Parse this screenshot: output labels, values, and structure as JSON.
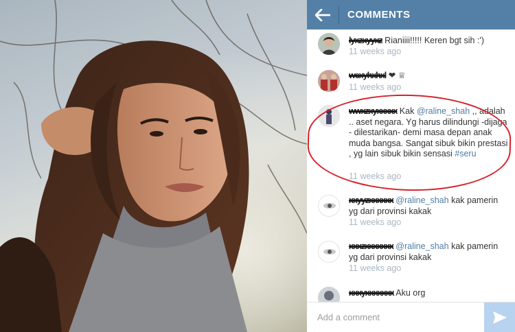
{
  "header": {
    "title": "COMMENTS",
    "back_icon": "arrow-left-icon"
  },
  "comments": [
    {
      "username": "lyxzxyyxz",
      "text": "Rianiiii!!!!! Keren bgt sih :')",
      "time": "11 weeks ago"
    },
    {
      "username": "wexyhxhxl",
      "text": "❤ ♕",
      "time": "11 weeks ago"
    },
    {
      "username": "wwxzxyxxxxx",
      "mention": "@raline_shah",
      "text": ",, adalah .. aset negara. Yg harus dilindungi -dijaga - dilestarikan- demi masa depan anak muda bangsa. Sangat sibuk bikin prestasi , yg lain sibuk bikin sensasi",
      "prefix": "Kak",
      "hashtag": "#seru",
      "time": "11 weeks ago"
    },
    {
      "username": "xxyyzxxxxxx",
      "mention": "@raline_shah",
      "text": "kak pamerin yg dari provinsi kakak",
      "time": "11 weeks ago"
    },
    {
      "username": "xxxzxxxxxxx",
      "mention": "@raline_shah",
      "text": "kak pamerin yg dari provinsi kakak",
      "time": "11 weeks ago"
    },
    {
      "username": "xxxyxxxxxxx",
      "text": "Aku org",
      "time": ""
    }
  ],
  "footer": {
    "placeholder": "Add a comment",
    "send_icon": "send-icon"
  },
  "colors": {
    "topbar": "#5480a7",
    "mention": "#4e7ca3",
    "timestamp": "#a9b6c3",
    "send_button": "#b7d3ef",
    "highlight": "#d4222a"
  }
}
